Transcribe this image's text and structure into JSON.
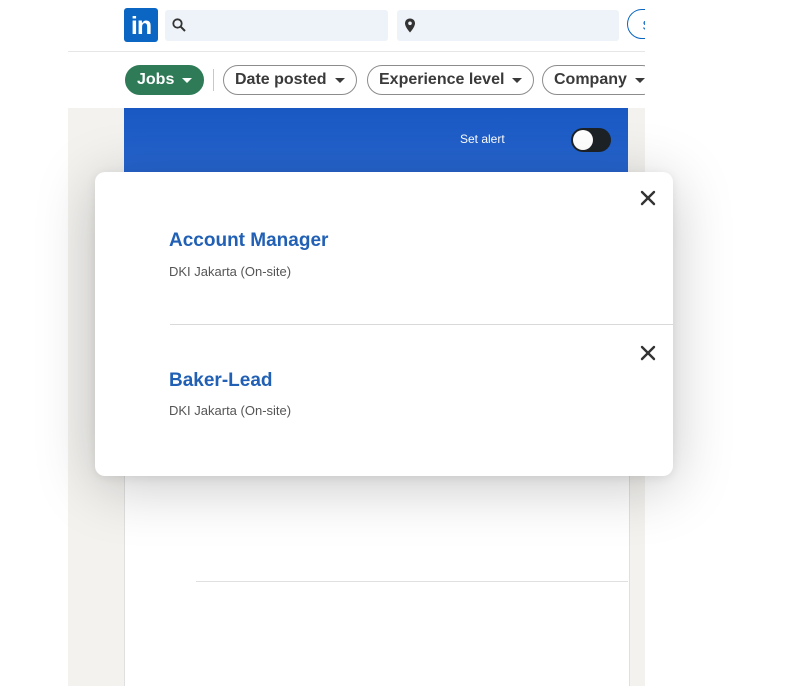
{
  "header": {
    "logo_text": "in",
    "keyword_search": {
      "value": "",
      "placeholder": ""
    },
    "location_search": {
      "value": "",
      "placeholder": ""
    },
    "signin_label": "S"
  },
  "filters": [
    {
      "label": "Jobs",
      "active": true
    },
    {
      "label": "Date posted",
      "active": false
    },
    {
      "label": "Experience level",
      "active": false
    },
    {
      "label": "Company",
      "active": false
    }
  ],
  "banner": {
    "alert_label": "Set alert",
    "alert_on": false
  },
  "popup": {
    "jobs": [
      {
        "title": "Account Manager",
        "location": "DKI Jakarta (On-site)"
      },
      {
        "title": "Baker-Lead",
        "location": "DKI Jakarta (On-site)"
      }
    ]
  },
  "colors": {
    "brand": "#0a66c2",
    "filter_active": "#2f7b57",
    "job_title": "#2160b5",
    "banner": "#1957c2"
  },
  "icons": {
    "search": "search-icon",
    "location": "location-pin-icon",
    "close": "close-icon",
    "caret": "caret-down-icon"
  }
}
